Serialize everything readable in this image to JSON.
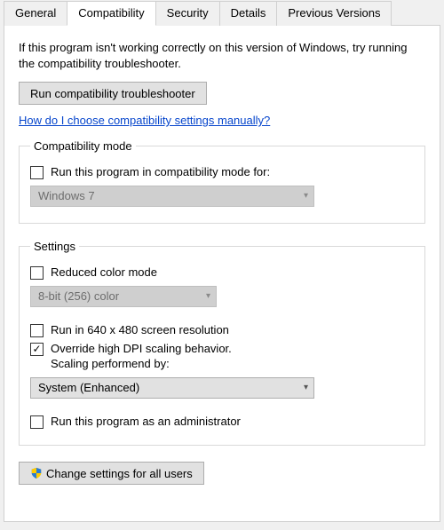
{
  "tabs": {
    "general": "General",
    "compatibility": "Compatibility",
    "security": "Security",
    "details": "Details",
    "previous": "Previous Versions",
    "active": "compatibility"
  },
  "intro": "If this program isn't working correctly on this version of Windows, try running the compatibility troubleshooter.",
  "buttons": {
    "troubleshooter": "Run compatibility troubleshooter",
    "allusers": "Change settings for all users"
  },
  "link": "How do I choose compatibility settings manually?",
  "groups": {
    "compatmode": {
      "legend": "Compatibility mode",
      "checkbox": "Run this program in compatibility mode for:",
      "select_value": "Windows 7"
    },
    "settings": {
      "legend": "Settings",
      "reduced_color": "Reduced color mode",
      "reduced_color_value": "8-bit (256) color",
      "low_res": "Run in 640 x 480 screen resolution",
      "dpi_line1": "Override high DPI scaling behavior.",
      "dpi_line2": "Scaling performend by:",
      "dpi_value": "System (Enhanced)",
      "admin": "Run this program as an administrator"
    }
  },
  "icons": {
    "shield": "shield-icon",
    "chevron": "chevron-down-icon"
  }
}
